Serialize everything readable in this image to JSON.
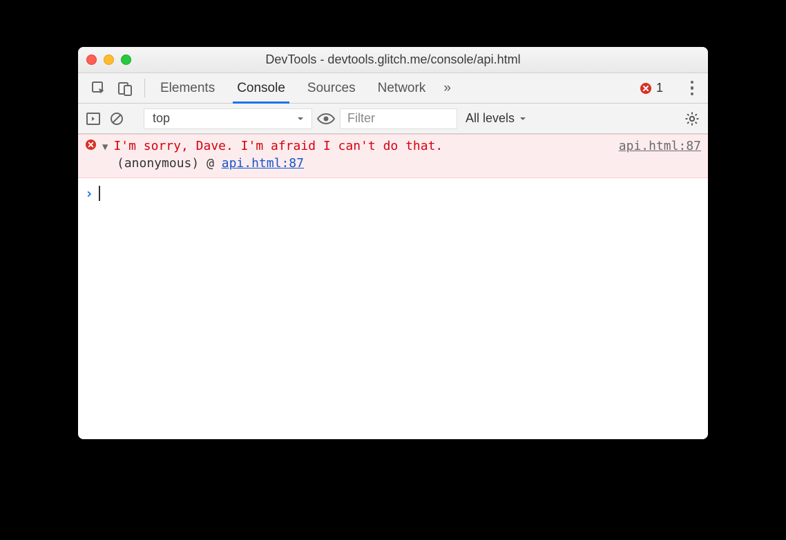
{
  "window": {
    "title": "DevTools - devtools.glitch.me/console/api.html"
  },
  "tabs": {
    "items": [
      "Elements",
      "Console",
      "Sources",
      "Network"
    ],
    "active_index": 1,
    "overflow_glyph": "»"
  },
  "error_indicator": {
    "count": "1"
  },
  "console_toolbar": {
    "context": "top",
    "filter_placeholder": "Filter",
    "level": "All levels"
  },
  "console": {
    "error": {
      "message": "I'm sorry, Dave. I'm afraid I can't do that.",
      "source": "api.html:87",
      "stack_label": "(anonymous)",
      "stack_at": "@",
      "stack_link": "api.html:87"
    },
    "prompt_glyph": "›"
  }
}
